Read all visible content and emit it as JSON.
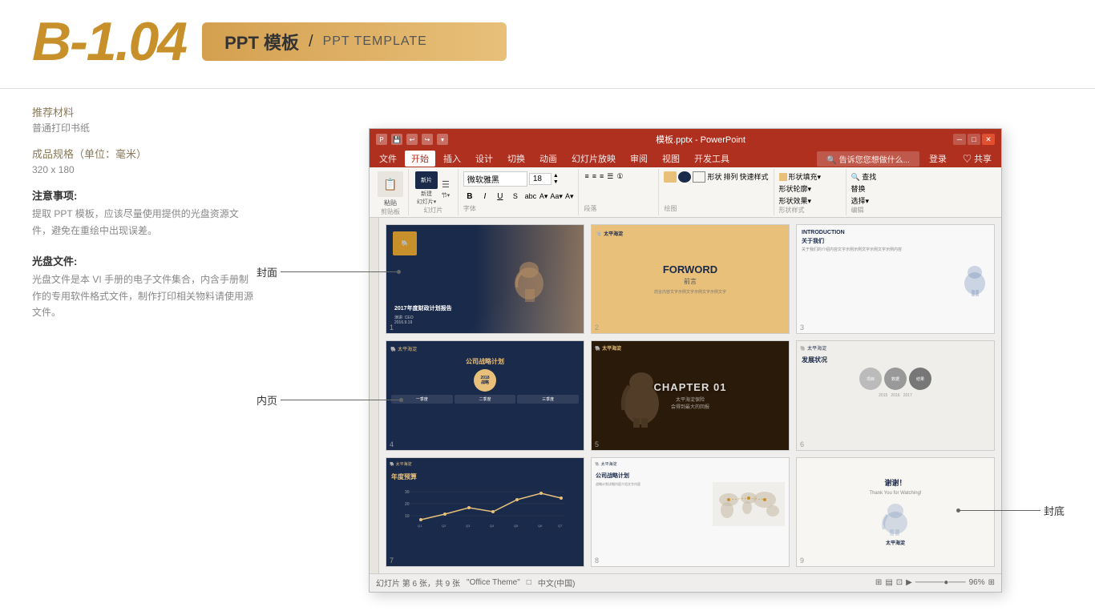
{
  "header": {
    "big_title": "B-1.04",
    "banner_zh": "PPT 模板",
    "banner_sep": "/",
    "banner_en": "PPT TEMPLATE"
  },
  "left_panel": {
    "material_title": "推荐材料",
    "material_content": "普通打印书纸",
    "size_title": "成品规格（单位：毫米）",
    "size_content": "320 x 180",
    "note_title": "注意事项:",
    "note_content": "提取 PPT 模板，应该尽量使用提供的光盘资源文件，避免在重绘中出现误差。",
    "disc_title": "光盘文件:",
    "disc_content": "光盘文件是本 VI 手册的电子文件集合，内含手册制作的专用软件格式文件，制作打印相关物料请使用源文件。"
  },
  "ppt_window": {
    "title": "模板.pptx - PowerPoint",
    "menu_items": [
      "文件",
      "开始",
      "插入",
      "设计",
      "切换",
      "动画",
      "幻灯片放映",
      "审阅",
      "视图",
      "开发工具"
    ],
    "login_text": "登录",
    "share_text": "♡ 共享",
    "paste_label": "粘贴",
    "new_slide_label": "新建\n幻灯片",
    "section_label": "节·",
    "clipboard_label": "剪贴板",
    "slides_label": "幻灯片",
    "font_label": "字体",
    "paragraph_label": "段落",
    "drawing_label": "绘图",
    "edit_label": "编辑",
    "format_section": "形状样式",
    "find_label": "查找",
    "replace_label": "形状轮廓·",
    "effect_label": "形状效果·",
    "select_label": "选择·"
  },
  "slides": [
    {
      "id": 1,
      "type": "cover",
      "bg_color": "#1a2a4a",
      "label": "封面",
      "title_zh": "2017年度财政计划报告",
      "subtitle": "演讲: CEO\n2016.9.19"
    },
    {
      "id": 2,
      "type": "foreword",
      "bg_color": "#e8c07a",
      "title_zh": "FORWORD",
      "subtitle_zh": "前言"
    },
    {
      "id": 3,
      "type": "intro",
      "title_en": "INTRODUCTION",
      "subtitle_zh": "关于我们"
    },
    {
      "id": 4,
      "type": "strategy",
      "bg_color": "#1a2a4a",
      "title_zh": "公司战略计划",
      "year": "2018\n战略规划"
    },
    {
      "id": 5,
      "type": "chapter",
      "bg_color": "#2a1a0a",
      "chapter_text": "CHAPTER 01",
      "subtitle": "太平海淀保险\n会得到最大的回报"
    },
    {
      "id": 6,
      "type": "development",
      "title_zh": "发展状况"
    },
    {
      "id": 7,
      "type": "budget",
      "bg_color": "#1a2a4a",
      "title_zh": "年度预算"
    },
    {
      "id": 8,
      "type": "world_map",
      "title_zh": "公司战略计划"
    },
    {
      "id": 9,
      "type": "end",
      "thanks_zh": "谢谢！",
      "label": "封底"
    }
  ],
  "annotations": {
    "cover_label": "封面",
    "inner_label": "内页",
    "back_label": "封底"
  },
  "status_bar": {
    "text": "幻灯片 第 6 张，共 9 张",
    "theme": "\"Office Theme\"",
    "language": "中文(中国)",
    "zoom": "96%"
  }
}
